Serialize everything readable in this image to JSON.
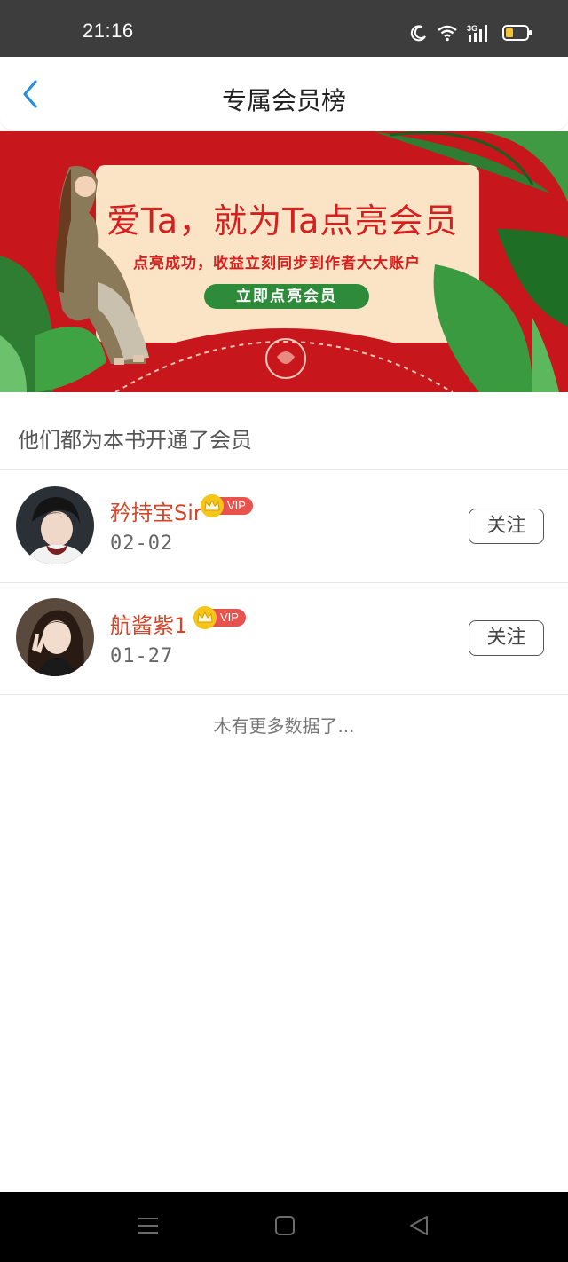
{
  "status_bar": {
    "time": "21:16",
    "network": "3G",
    "icons": [
      "moon-icon",
      "wifi-icon",
      "signal-icon",
      "battery-icon"
    ]
  },
  "header": {
    "title": "专属会员榜",
    "back_icon": "chevron-left-icon"
  },
  "banner": {
    "headline": "爱Ta，就为Ta点亮会员",
    "subtitle": "点亮成功，收益立刻同步到作者大大账户",
    "cta_label": "立即点亮会员"
  },
  "section": {
    "heading": "他们都为本书开通了会员"
  },
  "members": [
    {
      "name": "矜持宝Sir",
      "vip_label": "VIP",
      "date": "02-02",
      "follow_label": "关注"
    },
    {
      "name": "航酱紫1",
      "vip_label": "VIP",
      "date": "01-27",
      "follow_label": "关注"
    }
  ],
  "footer": {
    "no_more_text": "木有更多数据了..."
  },
  "nav_bar": {
    "icons": [
      "menu-icon",
      "home-icon",
      "back-triangle-icon"
    ]
  },
  "colors": {
    "accent_blue": "#2a8ee0",
    "name_red": "#d2462a",
    "banner_red": "#c8161d",
    "cta_green": "#2e8b3a",
    "vip_gold": "#f5c518",
    "vip_red": "#e8534d"
  }
}
